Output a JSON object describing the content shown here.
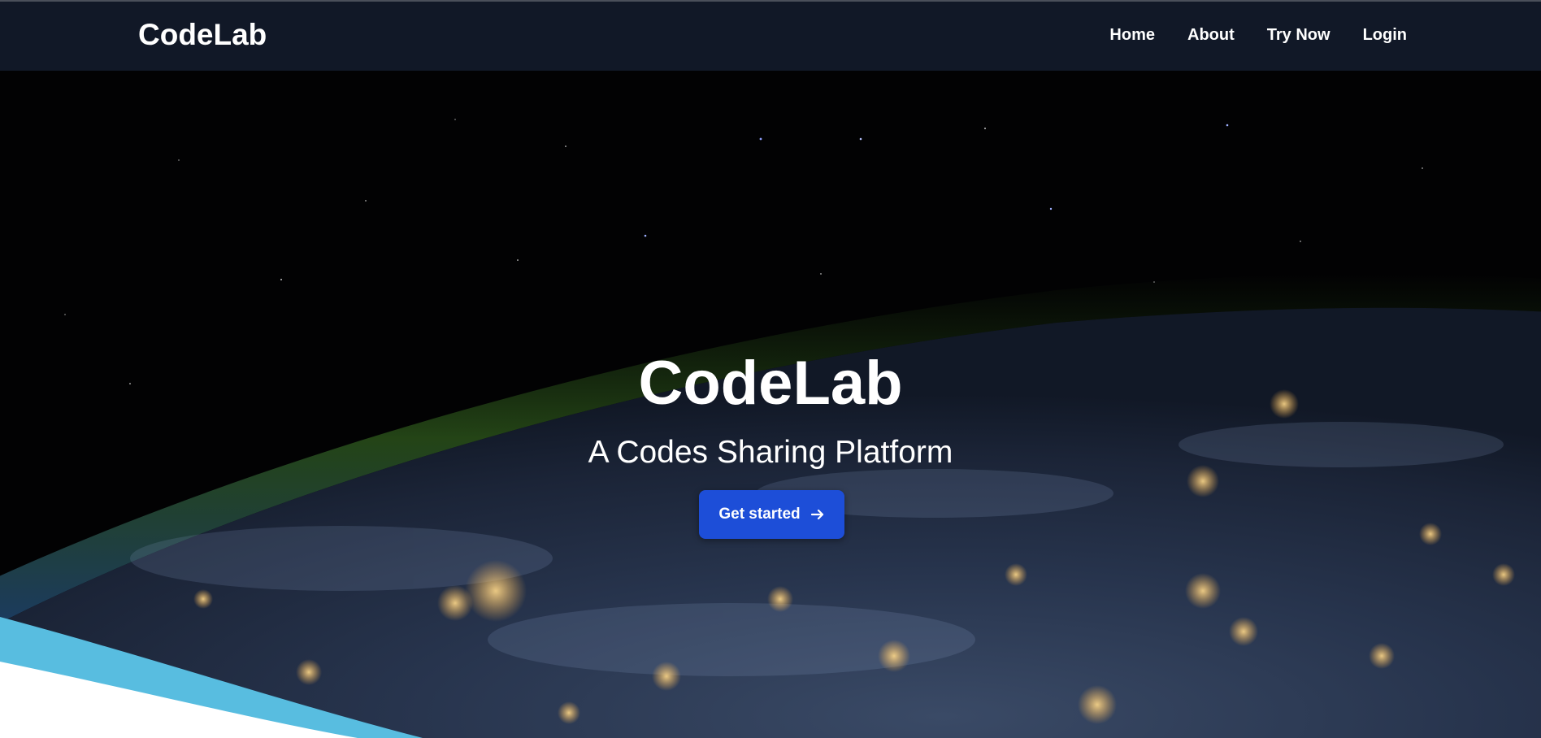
{
  "nav": {
    "brand": "CodeLab",
    "links": [
      {
        "label": "Home"
      },
      {
        "label": "About"
      },
      {
        "label": "Try Now"
      },
      {
        "label": "Login"
      }
    ]
  },
  "hero": {
    "title": "CodeLab",
    "subtitle": "A Codes Sharing Platform",
    "cta_label": "Get started",
    "cta_icon": "arrow-right-icon",
    "background": "earth-at-night-from-space"
  },
  "colors": {
    "navbar": "#111827",
    "cta": "#1d4ed8",
    "wave_accent": "#58bde0",
    "space": "#000000"
  }
}
